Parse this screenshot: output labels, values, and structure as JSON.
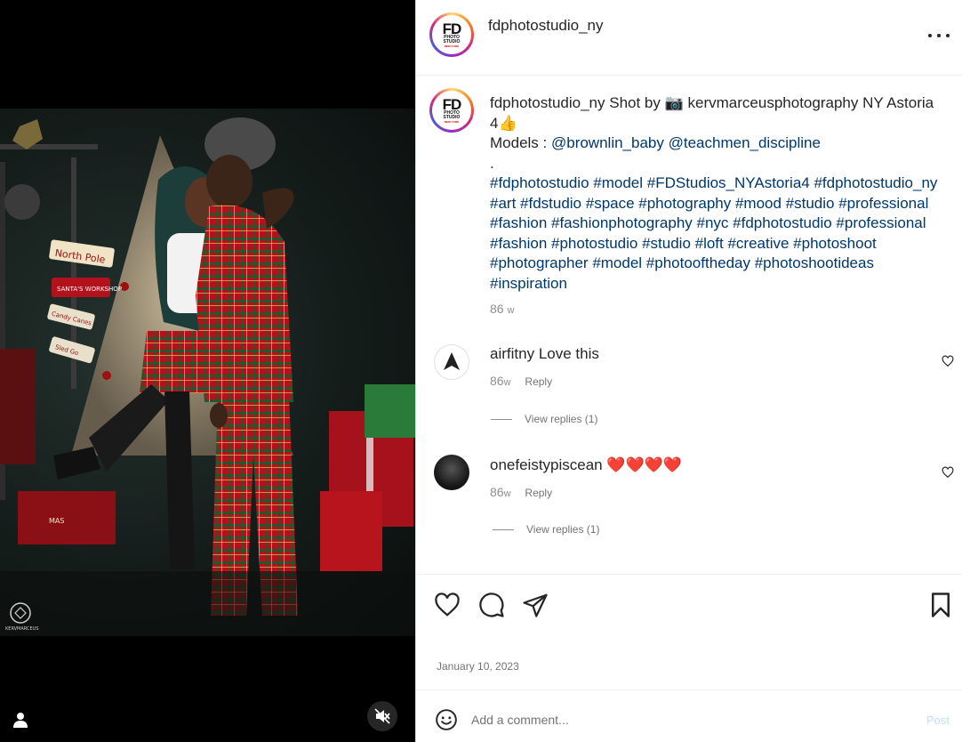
{
  "media": {
    "watermark": "KERVMARCEUS",
    "sign_north_pole": "North Pole",
    "sign_workshop": "SANTA'S WORKSHOP",
    "sign_candy": "Candy Canes",
    "sign_sled": "Sled Go",
    "sign_xmas": "MAS"
  },
  "header": {
    "username": "fdphotostudio_ny",
    "logo_main": "FD",
    "logo_line1": "PHOTO",
    "logo_line2": "STUDIO",
    "logo_line3": "NEW YORK"
  },
  "caption": {
    "username": "fdphotostudio_ny",
    "text_before_camera": "Shot by",
    "camera_emoji": "📷",
    "text_after_camera": "kervmarceusphotography NY Astoria 4",
    "thumbs_emoji": "👍",
    "models_label": "Models :",
    "model_tags": [
      "@brownlin_baby",
      "@teachmen_discipline"
    ],
    "dot": ".",
    "hashtags": "#fdphotostudio #model #FDStudios_NYAstoria4 #fdphotostudio_ny #art #fdstudio #space #photography #mood #studio #professional #fashion #fashionphotography #nyc #fdphotostudio #professional #fashion #photostudio #studio #loft #creative #photoshoot #photographer #model #photooftheday #photoshootideas  #inspiration",
    "time_num": "86",
    "time_unit": "w"
  },
  "comments": [
    {
      "username": "airfitny",
      "text": "Love this",
      "time_num": "86",
      "time_unit": "w",
      "reply_label": "Reply",
      "view_replies": "View replies (1)"
    },
    {
      "username": "onefeistypiscean",
      "text": "❤️❤️❤️❤️",
      "time_num": "86",
      "time_unit": "w",
      "reply_label": "Reply",
      "view_replies": "View replies (1)"
    }
  ],
  "actions": {
    "like_icon": "heart-icon",
    "comment_icon": "comment-bubble-icon",
    "share_icon": "paper-plane-icon",
    "save_icon": "bookmark-icon",
    "date": "January 10, 2023"
  },
  "add_comment": {
    "placeholder": "Add a comment...",
    "post_label": "Post"
  },
  "colors": {
    "link": "#00376b",
    "muted": "#737373",
    "post_disabled": "#c0dffd"
  }
}
